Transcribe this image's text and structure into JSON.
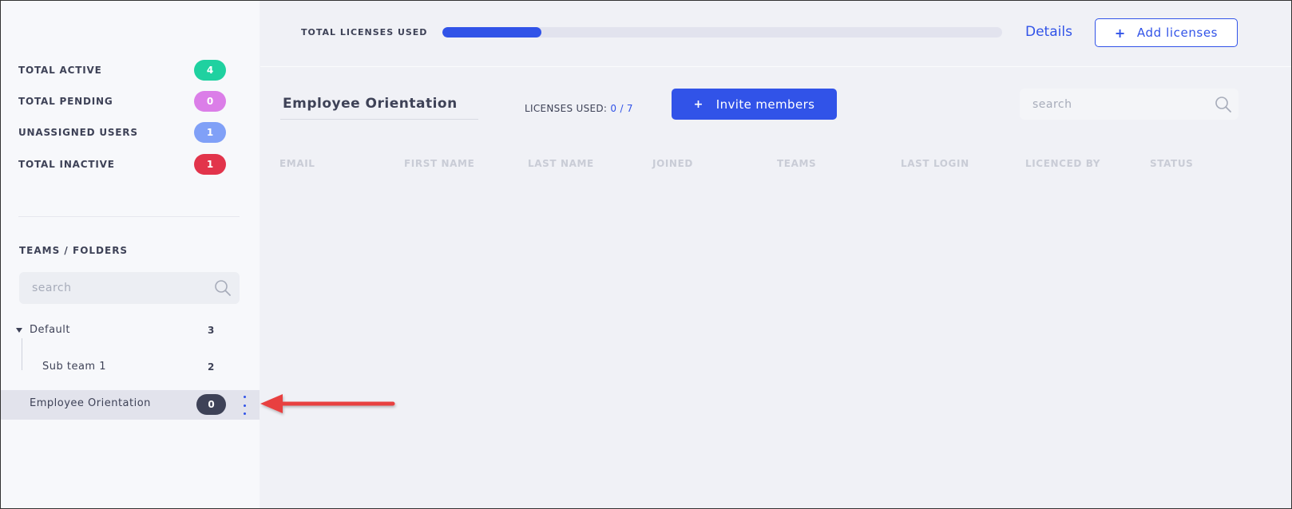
{
  "sidebar": {
    "stats": [
      {
        "label": "TOTAL ACTIVE",
        "count": "4",
        "color": "#1fd1a0"
      },
      {
        "label": "TOTAL PENDING",
        "count": "0",
        "color": "#db7ee8"
      },
      {
        "label": "UNASSIGNED USERS",
        "count": "1",
        "color": "#80a0f7"
      },
      {
        "label": "TOTAL INACTIVE",
        "count": "1",
        "color": "#e2344b"
      }
    ],
    "section_title": "TEAMS / FOLDERS",
    "search_placeholder": "search",
    "tree": [
      {
        "label": "Default",
        "count": "3"
      },
      {
        "label": "Sub team 1",
        "count": "2"
      },
      {
        "label": "Employee Orientation",
        "count": "0"
      }
    ]
  },
  "topbar": {
    "licenses_label": "TOTAL LICENSES USED",
    "licenses_used_fraction": 0.177,
    "details_label": "Details",
    "add_licenses_label": "Add licenses"
  },
  "main": {
    "team_title": "Employee Orientation",
    "licenses_used_label": "LICENSES USED:",
    "licenses_used_value": "0 / 7",
    "invite_label": "Invite members",
    "search_placeholder": "search",
    "columns": [
      "EMAIL",
      "FIRST NAME",
      "LAST NAME",
      "JOINED",
      "TEAMS",
      "LAST LOGIN",
      "LICENCED BY",
      "STATUS"
    ]
  },
  "colors": {
    "accent": "#3153e8",
    "annotation_arrow": "#e84040"
  }
}
